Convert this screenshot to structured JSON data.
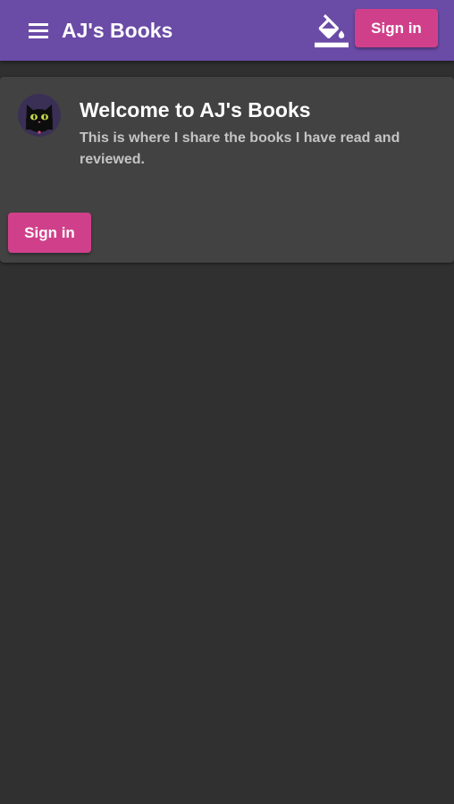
{
  "toolbar": {
    "title": "AJ's Books",
    "menu_icon": "menu-icon",
    "theme_icon": "format-color-fill-icon",
    "sign_in_label": "Sign in"
  },
  "welcome_card": {
    "avatar_icon": "black-cat-avatar",
    "title": "Welcome to AJ's Books",
    "subtitle": "This is where I share the books I have read and reviewed.",
    "sign_in_label": "Sign in"
  },
  "colors": {
    "toolbar": "#6a4ba6",
    "accent": "#d0408a",
    "background": "#303030",
    "card": "#424242"
  }
}
